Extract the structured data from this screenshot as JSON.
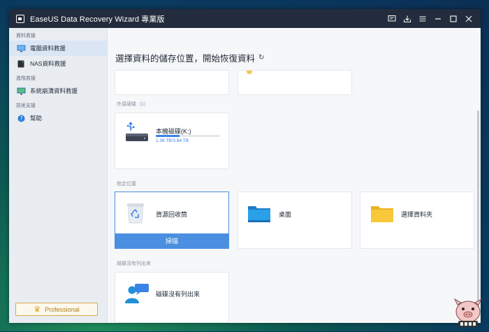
{
  "window": {
    "title": "EaseUS Data Recovery Wizard 專業版"
  },
  "sidebar": {
    "sections": [
      {
        "label": "資料救援",
        "items": [
          {
            "label": "電腦資料救援",
            "active": true,
            "icon": "monitor-icon"
          },
          {
            "label": "NAS資料救援",
            "active": false,
            "icon": "nas-icon"
          }
        ]
      },
      {
        "label": "進階救援",
        "items": [
          {
            "label": "系統崩潰資料救援",
            "active": false,
            "icon": "system-crash-icon"
          }
        ]
      },
      {
        "label": "技術支援",
        "items": [
          {
            "label": "幫助",
            "active": false,
            "icon": "help-icon"
          }
        ]
      }
    ],
    "pro_label": "Professional"
  },
  "main": {
    "title": "選擇資料的儲存位置，開始恢復資料",
    "external_section": "外接硬碟（1）",
    "disk": {
      "name": "本機磁碟(K:)",
      "size_text": "1.36 TB/3.64 TB",
      "used_fraction": 0.37
    },
    "location_section": "指定位置",
    "locations": [
      {
        "label": "資源回收筒",
        "icon": "recycle-bin-icon",
        "selected": true
      },
      {
        "label": "桌面",
        "icon": "desktop-icon",
        "selected": false
      },
      {
        "label": "選擇資料夾",
        "icon": "folder-icon",
        "selected": false
      }
    ],
    "scan_label": "掃描",
    "not_listed_section": "磁碟沒有列出來",
    "not_listed_label": "磁碟沒有列出來"
  },
  "colors": {
    "accent": "#4a8fe0",
    "titlebar": "#222c3c",
    "sidebar": "#e9edf2"
  }
}
